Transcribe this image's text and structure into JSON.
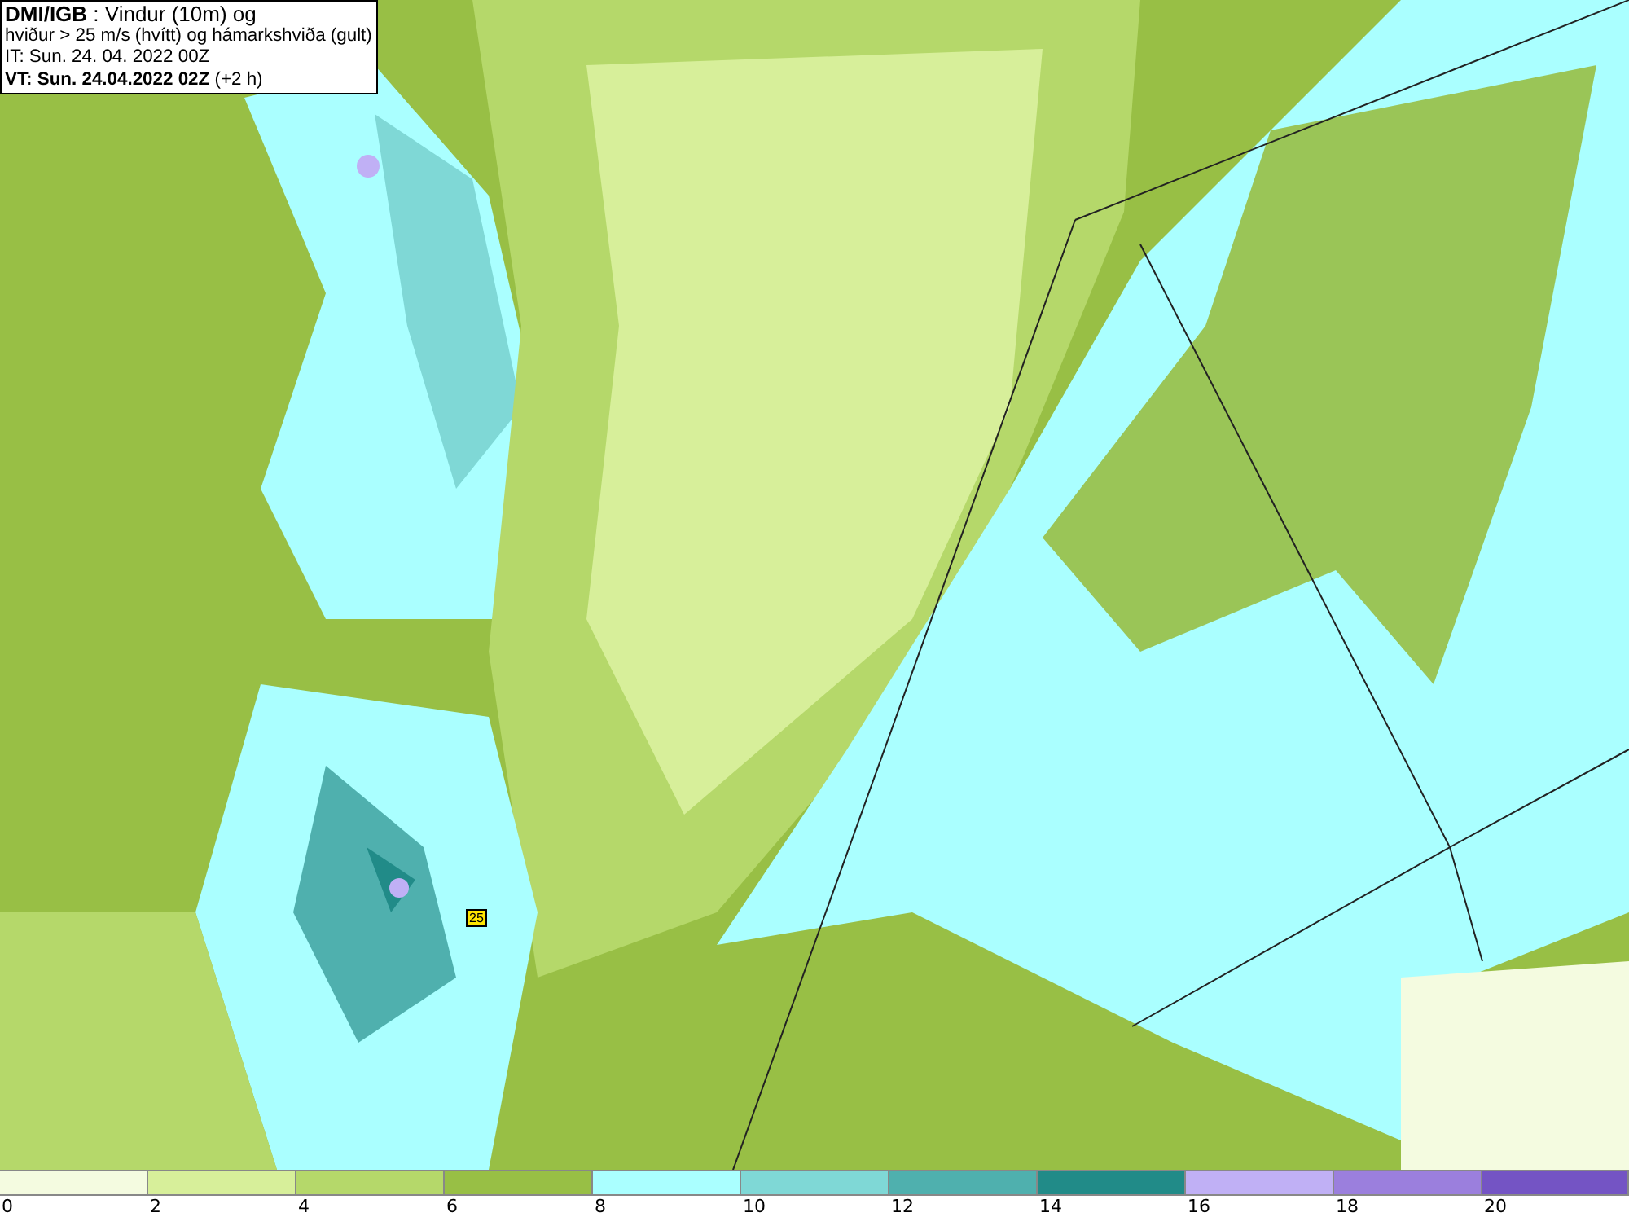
{
  "title_box": {
    "lines": [
      "**DMI/IGB** : Vindur (10m) og",
      "hviður > 25 m/s (hvítt) og hámarkshviða (gult)",
      "IT: Sun. 24. 04. 2022 00Z",
      "**VT: Sun. 24.04.2022 02Z** (+2 h)"
    ]
  },
  "map": {
    "markers": [
      {
        "label": "25"
      }
    ]
  },
  "legend": {
    "segments": [
      {
        "color": "#f4fbe0"
      },
      {
        "color": "#d7ef9a"
      },
      {
        "color": "#b5d86a"
      },
      {
        "color": "#98bf45"
      },
      {
        "color": "#aaffff"
      },
      {
        "color": "#7fd8d6"
      },
      {
        "color": "#4fb0ae"
      },
      {
        "color": "#218b88"
      },
      {
        "color": "#c0b0f5"
      },
      {
        "color": "#9b7fdd"
      },
      {
        "color": "#7454c4"
      }
    ],
    "ticks": [
      "0",
      "2",
      "4",
      "6",
      "8",
      "10",
      "12",
      "14",
      "16",
      "18",
      "20"
    ]
  }
}
